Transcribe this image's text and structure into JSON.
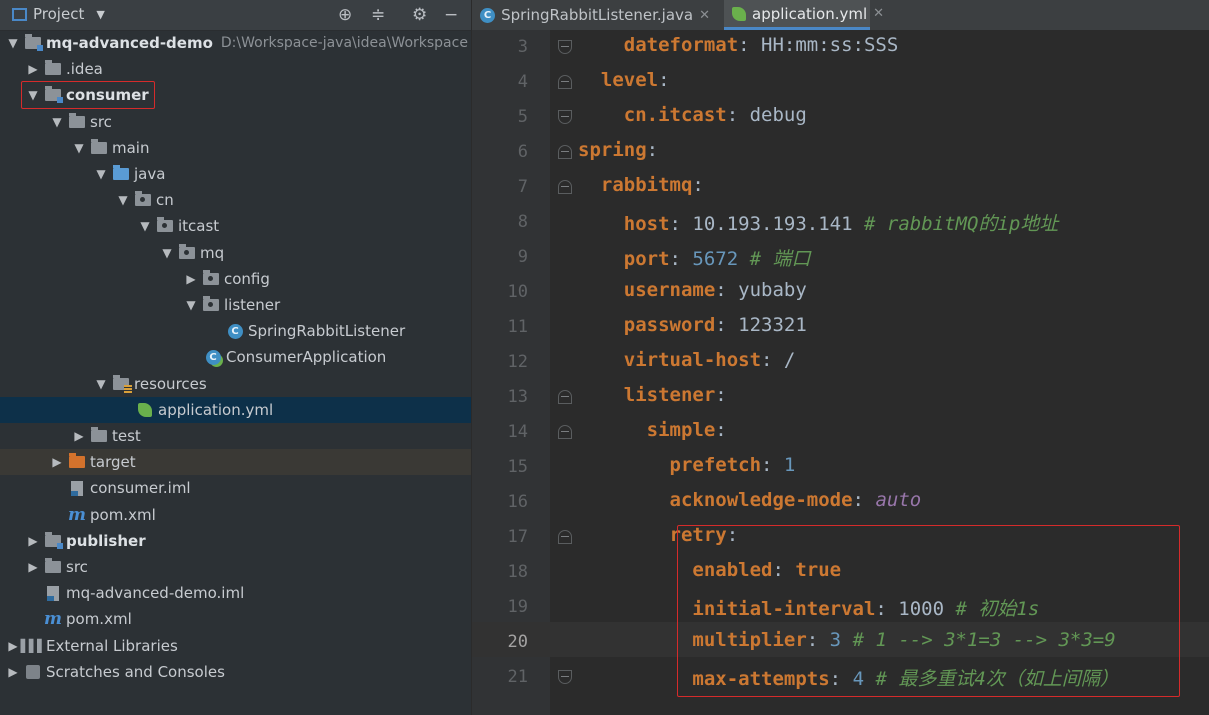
{
  "project_panel": {
    "title": "Project",
    "tools": [
      "locate-icon",
      "collapse-icon",
      "gear-icon",
      "minimize-icon"
    ],
    "tree": [
      {
        "label": "mq-advanced-demo",
        "hint": "D:\\Workspace-java\\idea\\Workspace",
        "icon": "module-folder-icon",
        "expanded": true,
        "bold": true
      },
      {
        "label": ".idea",
        "icon": "folder-icon",
        "expanded": false
      },
      {
        "label": "consumer",
        "icon": "module-folder-icon",
        "expanded": true,
        "bold": true,
        "highlighted": true
      },
      {
        "label": "src",
        "icon": "folder-icon",
        "expanded": true
      },
      {
        "label": "main",
        "icon": "folder-icon",
        "expanded": true
      },
      {
        "label": "java",
        "icon": "source-folder-icon",
        "expanded": true
      },
      {
        "label": "cn",
        "icon": "package-icon",
        "expanded": true
      },
      {
        "label": "itcast",
        "icon": "package-icon",
        "expanded": true
      },
      {
        "label": "mq",
        "icon": "package-icon",
        "expanded": true
      },
      {
        "label": "config",
        "icon": "package-icon",
        "expanded": false
      },
      {
        "label": "listener",
        "icon": "package-icon",
        "expanded": true
      },
      {
        "label": "SpringRabbitListener",
        "icon": "class-icon"
      },
      {
        "label": "ConsumerApplication",
        "icon": "spring-boot-class-icon"
      },
      {
        "label": "resources",
        "icon": "resources-folder-icon",
        "expanded": true
      },
      {
        "label": "application.yml",
        "icon": "spring-leaf-icon",
        "selected": true
      },
      {
        "label": "test",
        "icon": "folder-icon",
        "expanded": false
      },
      {
        "label": "target",
        "icon": "excluded-folder-icon",
        "expanded": false
      },
      {
        "label": "consumer.iml",
        "icon": "iml-file-icon"
      },
      {
        "label": "pom.xml",
        "icon": "maven-icon"
      },
      {
        "label": "publisher",
        "icon": "module-folder-icon",
        "expanded": false,
        "bold": true
      },
      {
        "label": "src",
        "icon": "folder-icon",
        "expanded": false
      },
      {
        "label": "mq-advanced-demo.iml",
        "icon": "iml-file-icon"
      },
      {
        "label": "pom.xml",
        "icon": "maven-icon"
      },
      {
        "label": "External Libraries",
        "icon": "libraries-icon",
        "expanded": false
      },
      {
        "label": "Scratches and Consoles",
        "icon": "scratches-icon",
        "expanded": false
      }
    ]
  },
  "tabs": [
    {
      "label": "SpringRabbitListener.java",
      "icon": "class-icon",
      "active": false
    },
    {
      "label": "application.yml",
      "icon": "spring-leaf-icon",
      "active": true
    }
  ],
  "editor": {
    "current_line": 20,
    "lines": [
      {
        "no": "3",
        "tokens": [
          {
            "t": "    "
          },
          {
            "t": "dateformat",
            "k": "key"
          },
          {
            "t": ": HH:mm:ss:SSS"
          }
        ]
      },
      {
        "no": "4",
        "tokens": [
          {
            "t": "  "
          },
          {
            "t": "level",
            "k": "key"
          },
          {
            "t": ":"
          }
        ]
      },
      {
        "no": "5",
        "tokens": [
          {
            "t": "    "
          },
          {
            "t": "cn.itcast",
            "k": "key"
          },
          {
            "t": ": debug"
          }
        ]
      },
      {
        "no": "6",
        "tokens": [
          {
            "t": "spring",
            "k": "key"
          },
          {
            "t": ":"
          }
        ]
      },
      {
        "no": "7",
        "tokens": [
          {
            "t": "  "
          },
          {
            "t": "rabbitmq",
            "k": "key"
          },
          {
            "t": ":"
          }
        ]
      },
      {
        "no": "8",
        "tokens": [
          {
            "t": "    "
          },
          {
            "t": "host",
            "k": "key"
          },
          {
            "t": ": 10.193.193.141 "
          },
          {
            "t": "# rabbitMQ的ip地址",
            "k": "comment"
          }
        ]
      },
      {
        "no": "9",
        "tokens": [
          {
            "t": "    "
          },
          {
            "t": "port",
            "k": "key"
          },
          {
            "t": ": "
          },
          {
            "t": "5672",
            "k": "num"
          },
          {
            "t": " "
          },
          {
            "t": "# 端口",
            "k": "comment"
          }
        ]
      },
      {
        "no": "10",
        "tokens": [
          {
            "t": "    "
          },
          {
            "t": "username",
            "k": "key"
          },
          {
            "t": ": yubaby"
          }
        ]
      },
      {
        "no": "11",
        "tokens": [
          {
            "t": "    "
          },
          {
            "t": "password",
            "k": "key"
          },
          {
            "t": ": 123321"
          }
        ]
      },
      {
        "no": "12",
        "tokens": [
          {
            "t": "    "
          },
          {
            "t": "virtual-host",
            "k": "key"
          },
          {
            "t": ": /"
          }
        ]
      },
      {
        "no": "13",
        "tokens": [
          {
            "t": "    "
          },
          {
            "t": "listener",
            "k": "key"
          },
          {
            "t": ":"
          }
        ]
      },
      {
        "no": "14",
        "tokens": [
          {
            "t": "      "
          },
          {
            "t": "simple",
            "k": "key"
          },
          {
            "t": ":"
          }
        ]
      },
      {
        "no": "15",
        "tokens": [
          {
            "t": "        "
          },
          {
            "t": "prefetch",
            "k": "key"
          },
          {
            "t": ": "
          },
          {
            "t": "1",
            "k": "num"
          }
        ]
      },
      {
        "no": "16",
        "tokens": [
          {
            "t": "        "
          },
          {
            "t": "acknowledge-mode",
            "k": "key"
          },
          {
            "t": ": "
          },
          {
            "t": "auto",
            "k": "ident"
          }
        ]
      },
      {
        "no": "17",
        "tokens": [
          {
            "t": "        "
          },
          {
            "t": "retry",
            "k": "key"
          },
          {
            "t": ":"
          }
        ]
      },
      {
        "no": "18",
        "tokens": [
          {
            "t": "          "
          },
          {
            "t": "enabled",
            "k": "key"
          },
          {
            "t": ": "
          },
          {
            "t": "true",
            "k": "key"
          }
        ]
      },
      {
        "no": "19",
        "tokens": [
          {
            "t": "          "
          },
          {
            "t": "initial-interval",
            "k": "key"
          },
          {
            "t": ": 1000 "
          },
          {
            "t": "# 初始1s",
            "k": "comment"
          }
        ]
      },
      {
        "no": "20",
        "tokens": [
          {
            "t": "          "
          },
          {
            "t": "multiplier",
            "k": "key"
          },
          {
            "t": ": "
          },
          {
            "t": "3",
            "k": "num"
          },
          {
            "t": " "
          },
          {
            "t": "# 1 --> 3*1=3 --> 3*3=9",
            "k": "comment"
          }
        ]
      },
      {
        "no": "21",
        "tokens": [
          {
            "t": "          "
          },
          {
            "t": "max-attempts",
            "k": "key"
          },
          {
            "t": ": "
          },
          {
            "t": "4",
            "k": "num"
          },
          {
            "t": " "
          },
          {
            "t": "# 最多重试4次（如上间隔）",
            "k": "comment"
          }
        ]
      }
    ]
  },
  "colors": {
    "key": "#cc7832",
    "number": "#6897bb",
    "comment": "#629755",
    "identifier": "#9876aa",
    "text": "#a9b7c6",
    "highlight_border": "#d52b2b"
  }
}
